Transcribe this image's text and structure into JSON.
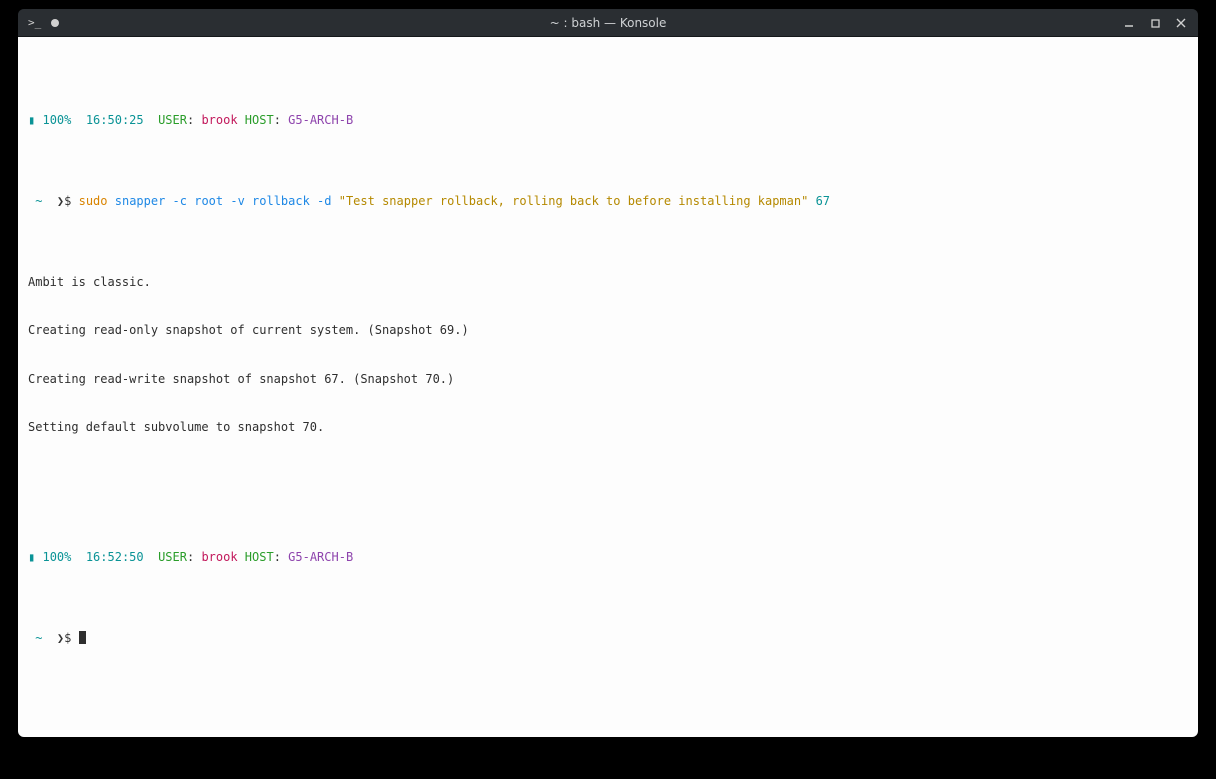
{
  "window": {
    "title": "~ : bash — Konsole",
    "tab_icon_text": ">_"
  },
  "prompt1": {
    "battery_icon": "▮",
    "battery": "100%",
    "time": "16:50:25",
    "user_label": "USER",
    "user": "brook",
    "host_label": "HOST",
    "host": "G5-ARCH-B",
    "cwd": "~",
    "arrow": "❯$",
    "cmd_sudo": "sudo",
    "cmd_rest": "snapper -c root -v rollback -d",
    "cmd_str": "\"Test snapper rollback, rolling back to before installing kapman\"",
    "cmd_tail": "67"
  },
  "output": {
    "l1": "Ambit is classic.",
    "l2": "Creating read-only snapshot of current system. (Snapshot 69.)",
    "l3": "Creating read-write snapshot of snapshot 67. (Snapshot 70.)",
    "l4": "Setting default subvolume to snapshot 70."
  },
  "prompt2": {
    "battery_icon": "▮",
    "battery": "100%",
    "time": "16:52:50",
    "user_label": "USER",
    "user": "brook",
    "host_label": "HOST",
    "host": "G5-ARCH-B",
    "cwd": "~",
    "arrow": "❯$"
  }
}
